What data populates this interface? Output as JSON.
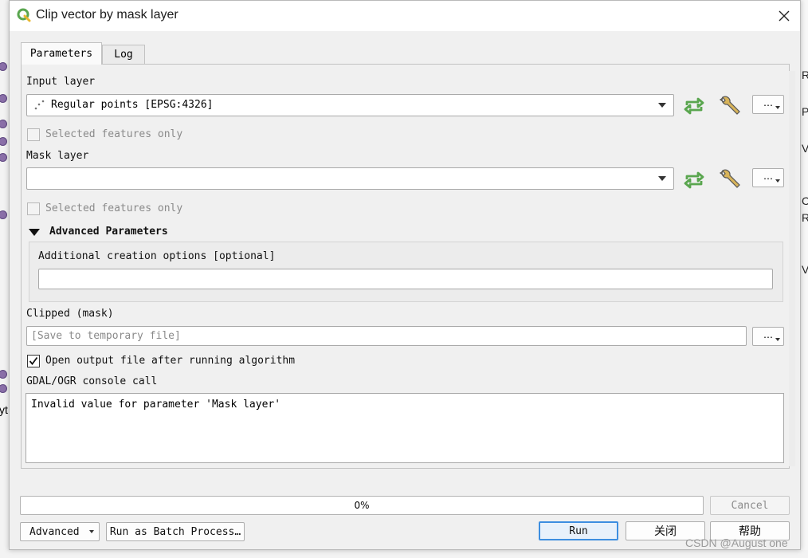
{
  "window": {
    "title": "Clip vector by mask layer",
    "app_icon": "qgis-icon",
    "close_icon": "close-icon"
  },
  "tabs": [
    {
      "label": "Parameters",
      "active": true
    },
    {
      "label": "Log",
      "active": false
    }
  ],
  "input_layer": {
    "label": "Input layer",
    "value": "Regular points [EPSG:4326]",
    "icon": "point-layer-icon",
    "selected_only_label": "Selected features only",
    "selected_only_checked": false,
    "dots_label": "…"
  },
  "mask_layer": {
    "label": "Mask layer",
    "value": "",
    "selected_only_label": "Selected features only",
    "selected_only_checked": false,
    "dots_label": "…"
  },
  "advanced": {
    "header": "Advanced Parameters",
    "expanded": true,
    "creation_options_label": "Additional creation options [optional]",
    "creation_options_value": ""
  },
  "output": {
    "label": "Clipped (mask)",
    "placeholder": "[Save to temporary file]",
    "dots_label": "…",
    "open_output_label": "Open output file after running algorithm",
    "open_output_checked": true
  },
  "console": {
    "label": "GDAL/OGR console call",
    "text": "Invalid value for parameter 'Mask layer'"
  },
  "footer": {
    "progress_text": "0%",
    "progress_value": 0,
    "cancel_label": "Cancel",
    "advanced_label": "Advanced",
    "batch_label": "Run as Batch Process…",
    "run_label": "Run",
    "close_label": "关闭",
    "help_label": "帮助"
  },
  "background": {
    "right_letters": [
      "R",
      "P",
      "V",
      "C",
      "R",
      "V"
    ],
    "left_fragment": "yt"
  },
  "watermark": "CSDN @August one",
  "colors": {
    "accent_green": "#5aa64f",
    "default_button_border": "#3d8ee0",
    "dialog_bg": "#f0f0f0"
  }
}
